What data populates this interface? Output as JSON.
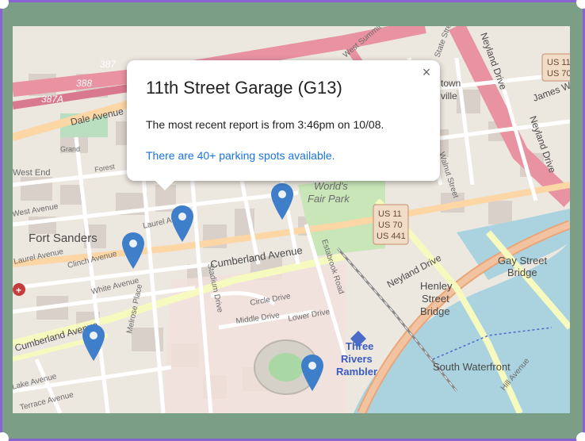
{
  "popup": {
    "title": "11th Street Garage (G13)",
    "report": "The most recent report is from 3:46pm on 10/08.",
    "spots": "There are 40+ parking spots available.",
    "close_symbol": "×"
  },
  "map_labels": {
    "fort_sanders": "Fort Sanders",
    "worlds_fair_park_1": "World's",
    "worlds_fair_park_2": "Fair Park",
    "cumberland_avenue": "Cumberland Avenue",
    "cumberland_avenue_left": "Cumberland Avenue",
    "clinch_avenue": "Clinch Avenue",
    "laurel_avenue": "Laurel Avenue",
    "laurel_avenue_left": "Laurel Avenue",
    "white_avenue": "White Avenue",
    "dale_avenue": "Dale Avenue",
    "neyland_drive": "Neyland Drive",
    "neyland_drive_top": "Neyland Drive",
    "james_white": "James W",
    "gay_street_bridge_1": "Gay Street",
    "gay_street_bridge_2": "Bridge",
    "henley_1": "Henley",
    "henley_2": "Street",
    "henley_3": "Bridge",
    "south_waterfront": "South Waterfront",
    "three_rivers_1": "Three",
    "three_rivers_2": "Rivers",
    "three_rivers_3": "Rambler",
    "circle_drive": "Circle Drive",
    "middle_drive": "Middle Drive",
    "lower_drive": "Lower Drive",
    "stadium_drive": "Stadium Drive",
    "estabrook_road": "Estabrook Road",
    "melrose_place": "Melrose Place",
    "lake_avenue": "Lake Avenue",
    "terrace_avenue": "Terrace Avenue",
    "west_end": "West End",
    "state_street": "State Street",
    "walnut_street": "Walnut Street",
    "west_summit": "West Summit",
    "hill_avenue": "Hill Avenue",
    "downtown_1": "town",
    "downtown_2": "ville",
    "us_shield_1": "US 11",
    "us_shield_2": "US 70",
    "us_shield_3": "US 441",
    "us_shield_tr_1": "US 11",
    "us_shield_tr_2": "US 70",
    "route_387": "387",
    "route_388": "388",
    "route_387a": "387A",
    "west_avenue": "West Avenue",
    "laurel_short": "Laurel Ave",
    "grand": "Grand",
    "forest": "Forest"
  },
  "markers": [
    {
      "name": "marker-1"
    },
    {
      "name": "marker-2"
    },
    {
      "name": "marker-3"
    },
    {
      "name": "marker-4"
    },
    {
      "name": "marker-5"
    }
  ],
  "colors": {
    "marker": "#3f7fca",
    "frame": "#7a9e86",
    "frame_border": "#8a63d2",
    "link": "#1a73e8",
    "river": "#aad3df",
    "motorway": "#e892a2",
    "primary": "#fcd6a4",
    "secondary": "#f7fabf"
  }
}
